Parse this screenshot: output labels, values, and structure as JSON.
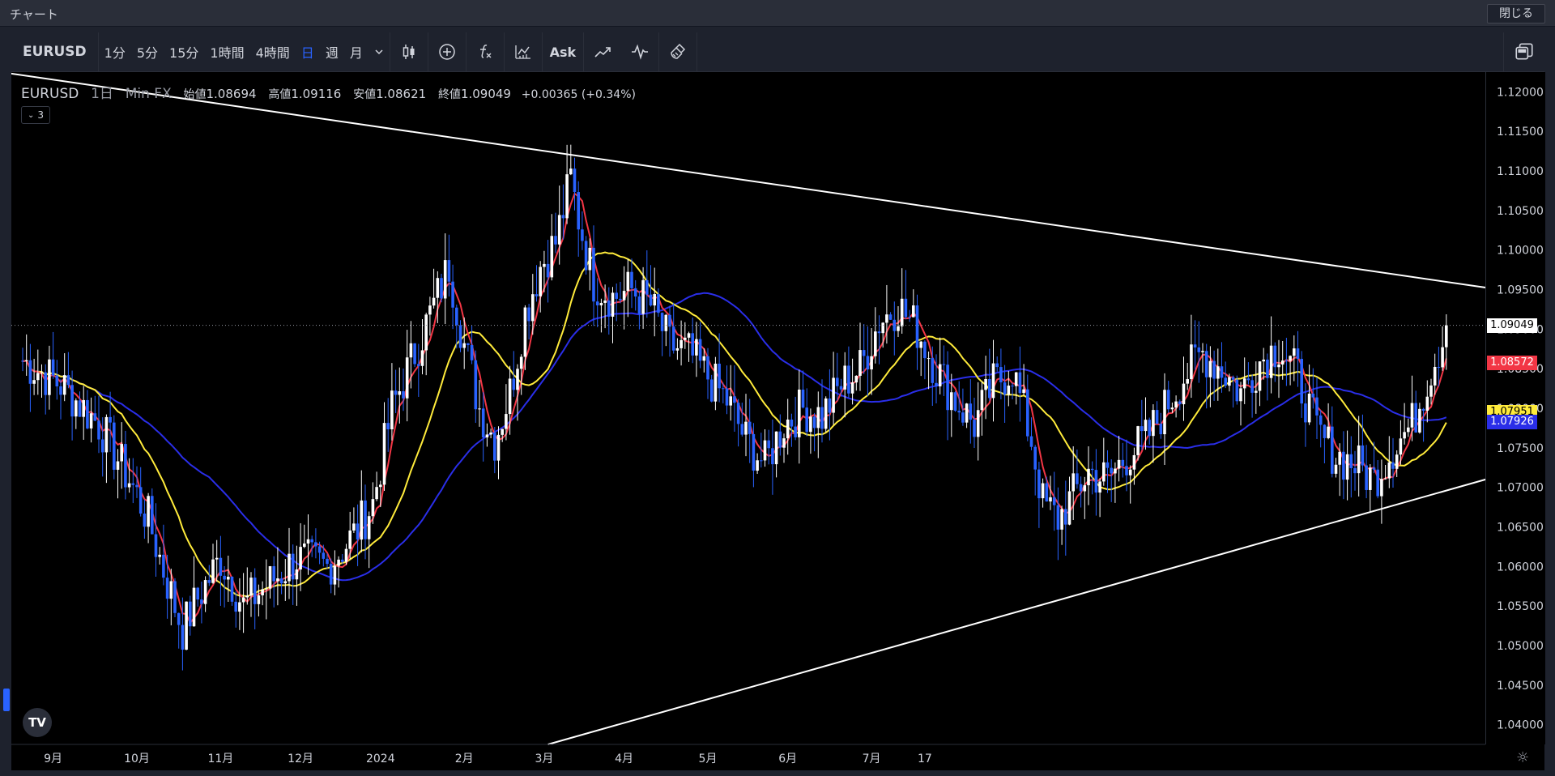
{
  "window": {
    "title": "チャート",
    "close_label": "閉じる"
  },
  "toolbar": {
    "symbol": "EURUSD",
    "intervals": [
      "1分",
      "5分",
      "15分",
      "1時間",
      "4時間",
      "日",
      "週",
      "月"
    ],
    "active_interval": "日",
    "ask_label": "Ask"
  },
  "legend": {
    "symbol": "EURUSD",
    "interval": "1日",
    "source": "Min FX",
    "open_label": "始値",
    "open": "1.08694",
    "high_label": "高値",
    "high": "1.09116",
    "low_label": "安値",
    "low": "1.08621",
    "close_label": "終値",
    "close": "1.09049",
    "change": "+0.00365 (+0.34%)",
    "indicator_toggle": "3"
  },
  "tags": {
    "last": "1.09049",
    "ma_red": "1.08572",
    "ma_yellow": "1.07951",
    "ma_blue": "1.07926"
  },
  "colors": {
    "background": "#000000",
    "up_candle": "#ffffff",
    "down_candle": "#2962ff",
    "ma_red": "#f23645",
    "ma_yellow": "#ffeb3b",
    "ma_blue": "#2a2ee8",
    "trendline": "#ffffff"
  },
  "chart_data": {
    "type": "candlestick",
    "symbol": "EURUSD",
    "timeframe": "1日",
    "ylim": [
      1.0375,
      1.1225
    ],
    "y_ticks": [
      "1.12000",
      "1.11500",
      "1.11000",
      "1.10500",
      "1.10000",
      "1.09500",
      "1.09000",
      "1.08500",
      "1.08000",
      "1.07500",
      "1.07000",
      "1.06500",
      "1.06000",
      "1.05500",
      "1.05000",
      "1.04500",
      "1.04000"
    ],
    "x_ticks": [
      "9月",
      "10月",
      "11月",
      "12月",
      "2024",
      "2月",
      "3月",
      "4月",
      "5月",
      "6月",
      "7月",
      "17"
    ],
    "close_path": [
      [
        0,
        1.086
      ],
      [
        10,
        1.083
      ],
      [
        20,
        1.078
      ],
      [
        28,
        1.071
      ],
      [
        33,
        1.066
      ],
      [
        38,
        1.058
      ],
      [
        42,
        1.052
      ],
      [
        46,
        1.056
      ],
      [
        52,
        1.061
      ],
      [
        58,
        1.055
      ],
      [
        65,
        1.058
      ],
      [
        72,
        1.061
      ],
      [
        80,
        1.06
      ],
      [
        87,
        1.064
      ],
      [
        92,
        1.068
      ],
      [
        97,
        1.08
      ],
      [
        103,
        1.087
      ],
      [
        108,
        1.093
      ],
      [
        112,
        1.098
      ],
      [
        116,
        1.088
      ],
      [
        120,
        1.08
      ],
      [
        124,
        1.076
      ],
      [
        128,
        1.082
      ],
      [
        132,
        1.092
      ],
      [
        136,
        1.098
      ],
      [
        140,
        1.101
      ],
      [
        144,
        1.109
      ],
      [
        146,
        1.104
      ],
      [
        150,
        1.096
      ],
      [
        155,
        1.094
      ],
      [
        160,
        1.095
      ],
      [
        165,
        1.093
      ],
      [
        170,
        1.088
      ],
      [
        175,
        1.087
      ],
      [
        180,
        1.084
      ],
      [
        185,
        1.081
      ],
      [
        190,
        1.076
      ],
      [
        195,
        1.073
      ],
      [
        200,
        1.078
      ],
      [
        205,
        1.08
      ],
      [
        210,
        1.079
      ],
      [
        215,
        1.083
      ],
      [
        220,
        1.085
      ],
      [
        225,
        1.091
      ],
      [
        230,
        1.093
      ],
      [
        235,
        1.09
      ],
      [
        240,
        1.085
      ],
      [
        245,
        1.081
      ],
      [
        250,
        1.078
      ],
      [
        255,
        1.083
      ],
      [
        260,
        1.085
      ],
      [
        265,
        1.076
      ],
      [
        268,
        1.068
      ],
      [
        272,
        1.066
      ],
      [
        276,
        1.069
      ],
      [
        280,
        1.072
      ],
      [
        285,
        1.071
      ],
      [
        290,
        1.074
      ],
      [
        295,
        1.076
      ],
      [
        300,
        1.08
      ],
      [
        305,
        1.084
      ],
      [
        310,
        1.087
      ],
      [
        315,
        1.085
      ],
      [
        320,
        1.082
      ],
      [
        325,
        1.086
      ],
      [
        330,
        1.088
      ],
      [
        335,
        1.084
      ],
      [
        340,
        1.077
      ],
      [
        345,
        1.074
      ],
      [
        350,
        1.073
      ],
      [
        355,
        1.071
      ],
      [
        360,
        1.075
      ],
      [
        365,
        1.078
      ],
      [
        370,
        1.085
      ],
      [
        374,
        1.09
      ]
    ],
    "trendlines": [
      {
        "name": "upper",
        "from": [
          -20,
          1.1235
        ],
        "to": [
          388,
          1.095
        ]
      },
      {
        "name": "lower",
        "from": [
          138,
          1.0375
        ],
        "to": [
          388,
          1.0715
        ]
      }
    ],
    "moving_averages": [
      {
        "color": "red",
        "last": 1.08572
      },
      {
        "color": "yellow",
        "last": 1.07951
      },
      {
        "color": "blue",
        "last": 1.07926
      }
    ],
    "last_close": 1.09049
  }
}
